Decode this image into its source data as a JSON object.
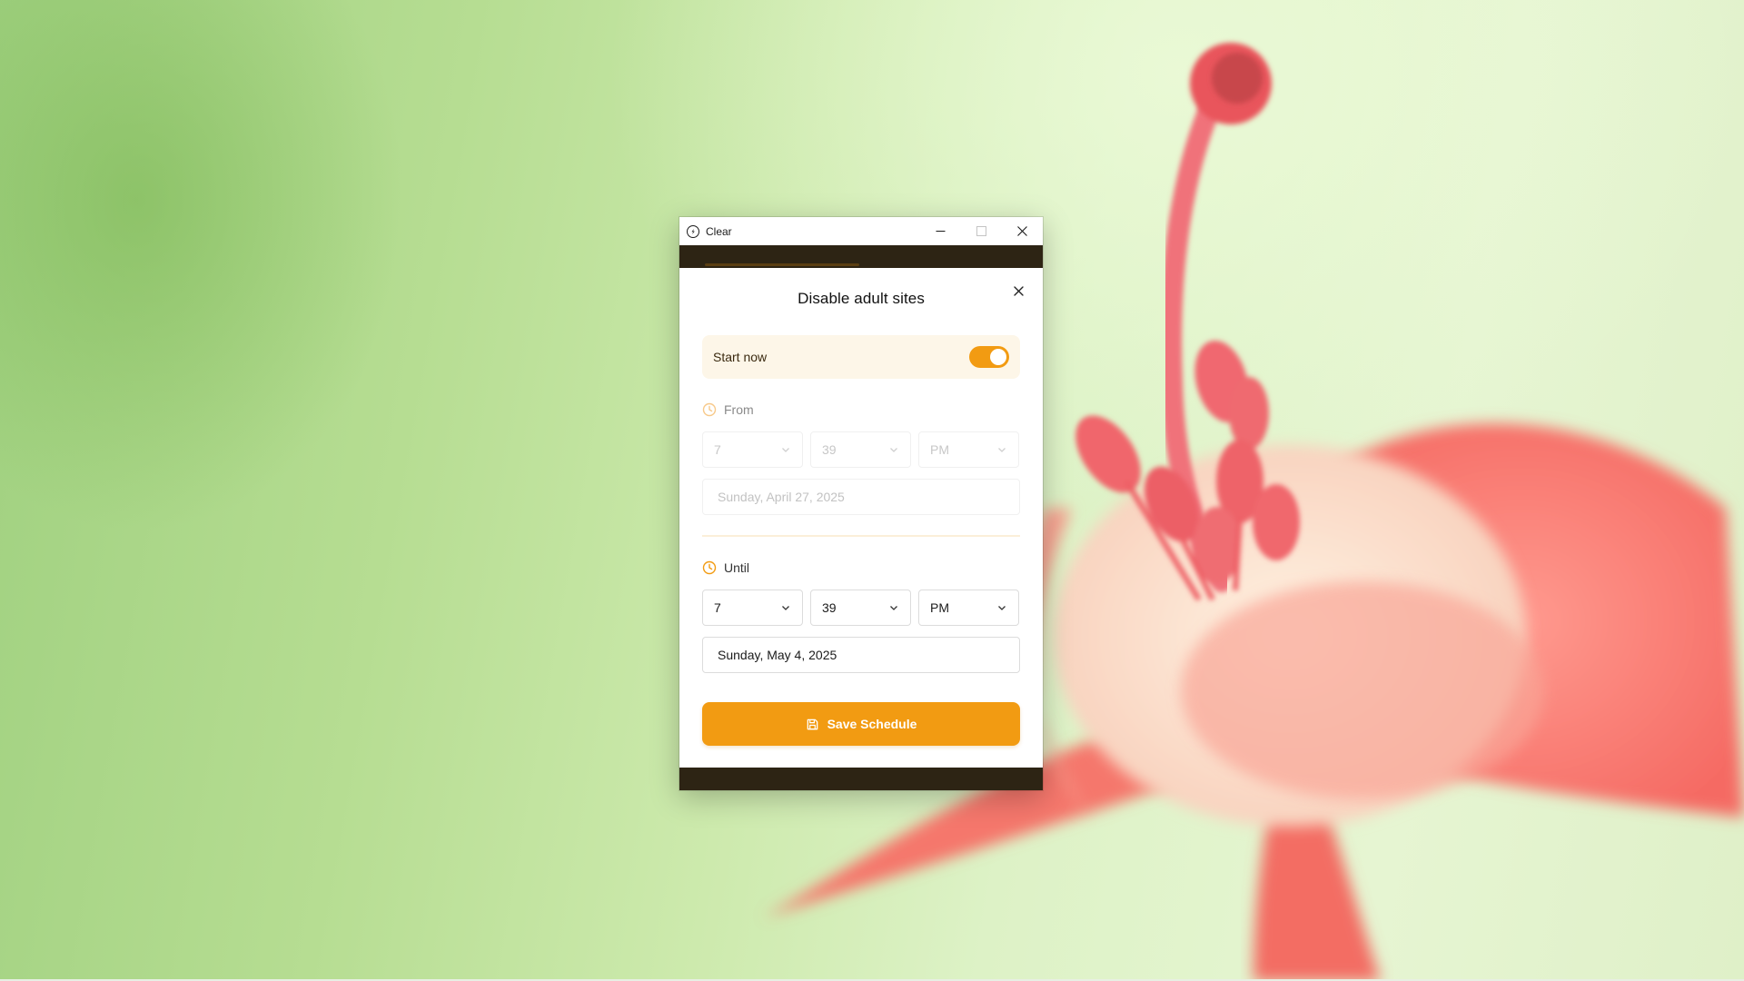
{
  "window": {
    "title": "Clear",
    "controls": {
      "minimize": "minimize-icon",
      "maximize": "maximize-icon",
      "close": "close-icon"
    }
  },
  "modal": {
    "title": "Disable adult sites",
    "close_icon": "close-icon",
    "start_now": {
      "label": "Start now",
      "enabled": true
    },
    "from": {
      "label": "From",
      "hour": "7",
      "minute": "39",
      "period": "PM",
      "date": "Sunday, April 27, 2025",
      "disabled": true
    },
    "until": {
      "label": "Until",
      "hour": "7",
      "minute": "39",
      "period": "PM",
      "date": "Sunday, May 4, 2025"
    },
    "save_label": "Save Schedule"
  },
  "colors": {
    "accent": "#f29b12",
    "accent_soft": "#fdf6e8",
    "band": "#2d2414"
  }
}
